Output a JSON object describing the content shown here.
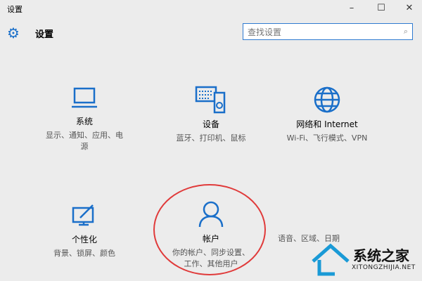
{
  "window": {
    "title": "设置",
    "minimize": "–",
    "maximize": "☐",
    "close": "✕"
  },
  "header": {
    "title": "设置",
    "icon": "gear-icon"
  },
  "search": {
    "placeholder": "查找设置",
    "icon": "search-icon"
  },
  "tiles": [
    {
      "name": "系统",
      "desc": "显示、通知、应用、电源",
      "icon": "laptop-icon"
    },
    {
      "name": "设备",
      "desc": "蓝牙、打印机、鼠标",
      "icon": "devices-icon"
    },
    {
      "name": "网络和 Internet",
      "desc": "Wi-Fi、飞行模式、VPN",
      "icon": "globe-icon"
    },
    {
      "name": "个性化",
      "desc": "背景、锁屏、颜色",
      "icon": "personalization-icon"
    },
    {
      "name": "帐户",
      "desc": "你的帐户、同步设置、工作、其他用户",
      "icon": "person-icon"
    },
    {
      "name": "",
      "desc": "语音、区域、日期",
      "icon": "language-icon"
    }
  ],
  "watermark": {
    "cn": "系统之家",
    "en": "XITONGZHIJIA.NET"
  },
  "colors": {
    "accent": "#1a6fc9",
    "annotation": "#e03a3a"
  }
}
